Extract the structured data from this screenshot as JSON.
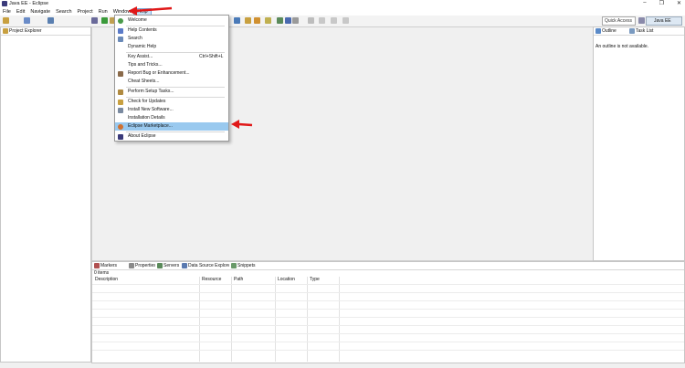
{
  "window": {
    "title": "Java EE - Eclipse",
    "minimize": "‒",
    "restore": "❐",
    "close": "✕"
  },
  "menubar": [
    "File",
    "Edit",
    "Navigate",
    "Search",
    "Project",
    "Run",
    "Window",
    "Help"
  ],
  "toolbar": {
    "quick_access_placeholder": "Quick Access",
    "perspective": "Java EE"
  },
  "project_explorer": {
    "tab": "Project Explorer"
  },
  "outline": {
    "tab": "Outline",
    "task_list_tab": "Task List",
    "message": "An outline is not available."
  },
  "help_menu": {
    "items": [
      {
        "label": "Welcome",
        "icon": "welcome-icon"
      },
      {
        "label": "Help Contents",
        "icon": "help-icon"
      },
      {
        "label": "Search",
        "icon": "search-icon"
      },
      {
        "label": "Dynamic Help",
        "icon": ""
      },
      {
        "label": "Key Assist...",
        "shortcut": "Ctrl+Shift+L"
      },
      {
        "label": "Tips and Tricks..."
      },
      {
        "label": "Report Bug or Enhancement...",
        "icon": "bug-icon"
      },
      {
        "label": "Cheat Sheets..."
      },
      {
        "label": "Perform Setup Tasks...",
        "icon": "setup-icon"
      },
      {
        "label": "Check for Updates",
        "icon": "update-icon"
      },
      {
        "label": "Install New Software...",
        "icon": "install-icon"
      },
      {
        "label": "Installation Details",
        "icon": ""
      },
      {
        "label": "Eclipse Marketplace...",
        "icon": "marketplace-icon",
        "highlighted": true
      },
      {
        "label": "About Eclipse",
        "icon": "about-icon"
      }
    ]
  },
  "bottom_panel": {
    "tabs": [
      "Markers",
      "Properties",
      "Servers",
      "Data Source Explorer",
      "Snippets"
    ],
    "items_count": "0 items",
    "columns": [
      "Description",
      "Resource",
      "Path",
      "Location",
      "Type"
    ]
  },
  "colors": {
    "highlight": "#99c9ef",
    "annotation_arrow": "#e01818"
  }
}
